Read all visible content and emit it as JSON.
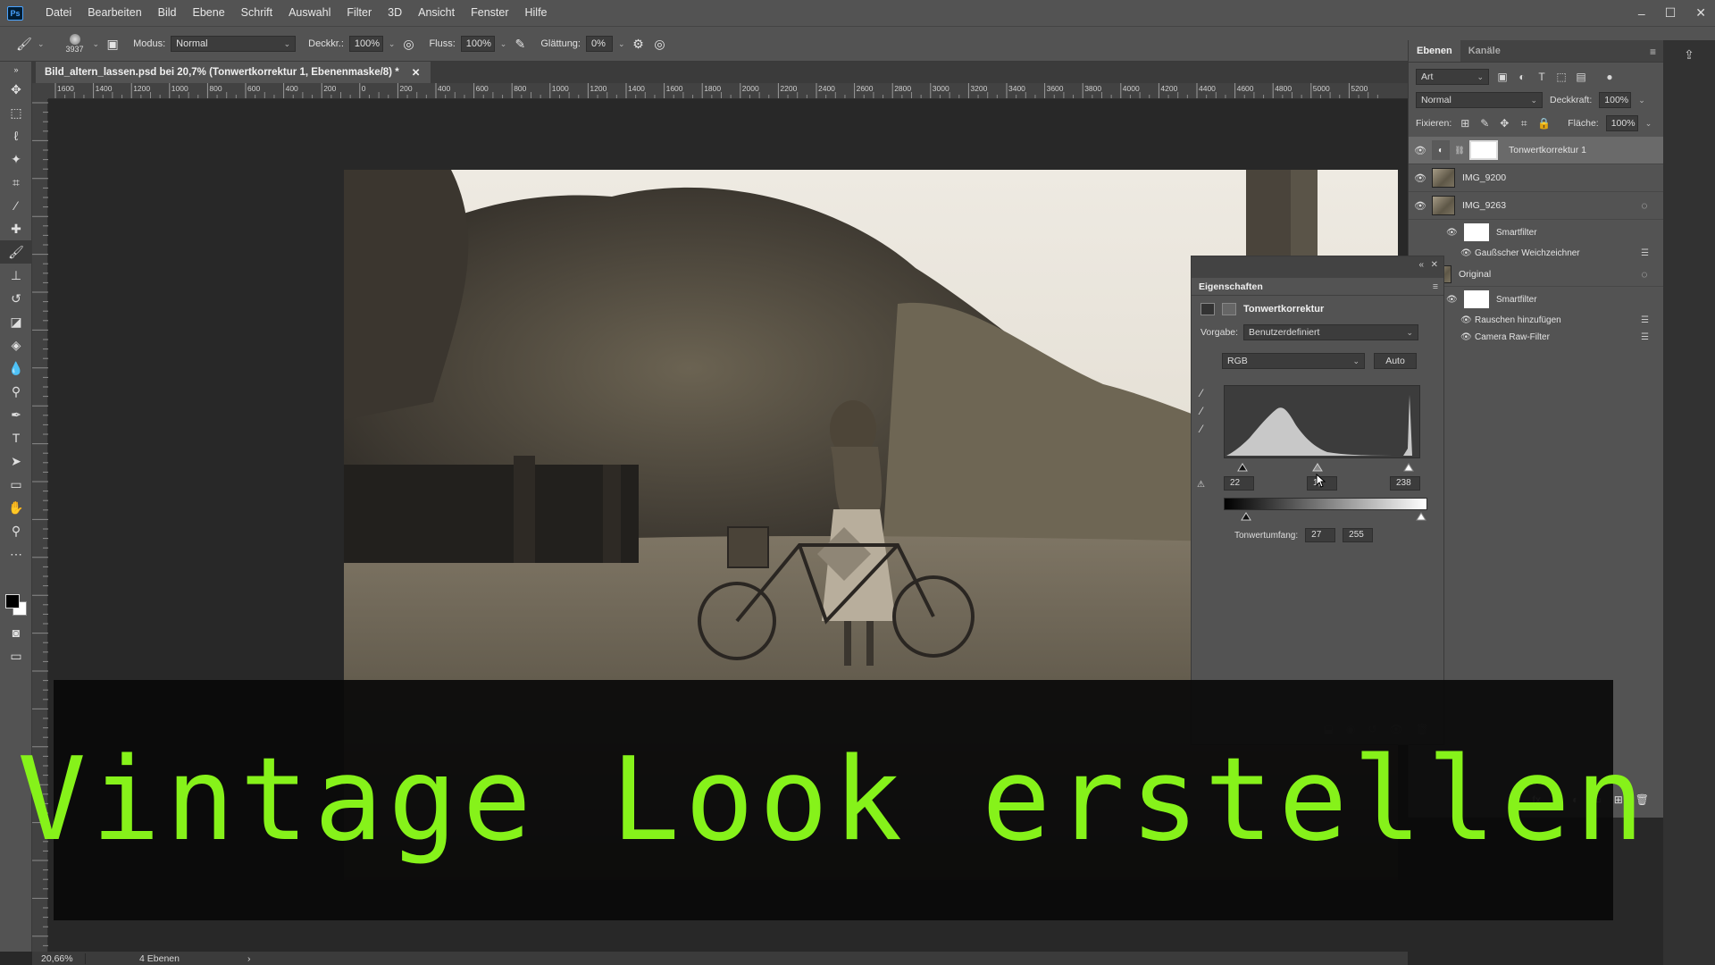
{
  "menubar": {
    "logo": "Ps",
    "items": [
      "Datei",
      "Bearbeiten",
      "Bild",
      "Ebene",
      "Schrift",
      "Auswahl",
      "Filter",
      "3D",
      "Ansicht",
      "Fenster",
      "Hilfe"
    ]
  },
  "options": {
    "brush_size": "3937",
    "mode_label": "Modus:",
    "mode_value": "Normal",
    "opacity_label": "Deckkr.:",
    "opacity_value": "100%",
    "flow_label": "Fluss:",
    "flow_value": "100%",
    "smoothing_label": "Glättung:",
    "smoothing_value": "0%"
  },
  "document": {
    "tab_title": "Bild_altern_lassen.psd bei 20,7% (Tonwertkorrektur 1, Ebenenmaske/8) *",
    "ruler_ticks": [
      "1600",
      "1400",
      "1200",
      "1000",
      "800",
      "600",
      "400",
      "200",
      "0",
      "200",
      "400",
      "600",
      "800",
      "1000",
      "1200",
      "1400",
      "1600",
      "1800",
      "2000",
      "2200",
      "2400",
      "2600",
      "2800",
      "3000",
      "3200",
      "3400",
      "3600",
      "3800",
      "4000",
      "4200",
      "4400",
      "4600",
      "4800",
      "5000",
      "5200"
    ]
  },
  "status": {
    "zoom": "20,66%",
    "layers_info": "4 Ebenen"
  },
  "layers_panel": {
    "tabs": [
      "Ebenen",
      "Kanäle"
    ],
    "filter_kind": "Art",
    "blend_mode": "Normal",
    "opacity_label": "Deckkraft:",
    "opacity_value": "100%",
    "lock_label": "Fixieren:",
    "fill_label": "Fläche:",
    "fill_value": "100%",
    "layers": {
      "l1": "Tonwertkorrektur 1",
      "l2": "IMG_9200",
      "l3": "IMG_9263",
      "l3_smart": "Smartfilter",
      "l3_f1": "Gaußscher Weichzeichner",
      "l4": "Original",
      "l4_smart": "Smartfilter",
      "l4_f1": "Rauschen hinzufügen",
      "l4_f2": "Camera Raw-Filter"
    }
  },
  "properties": {
    "title": "Eigenschaften",
    "adjustment": "Tonwertkorrektur",
    "preset_label": "Vorgabe:",
    "preset_value": "Benutzerdefiniert",
    "channel": "RGB",
    "auto_label": "Auto",
    "input_black": "22",
    "input_gamma": "1,",
    "input_white": "238",
    "output_label": "Tonwertumfang:",
    "output_black": "27",
    "output_white": "255"
  },
  "banner": {
    "text": "Vintage Look erstellen",
    "color": "#86f21a"
  }
}
